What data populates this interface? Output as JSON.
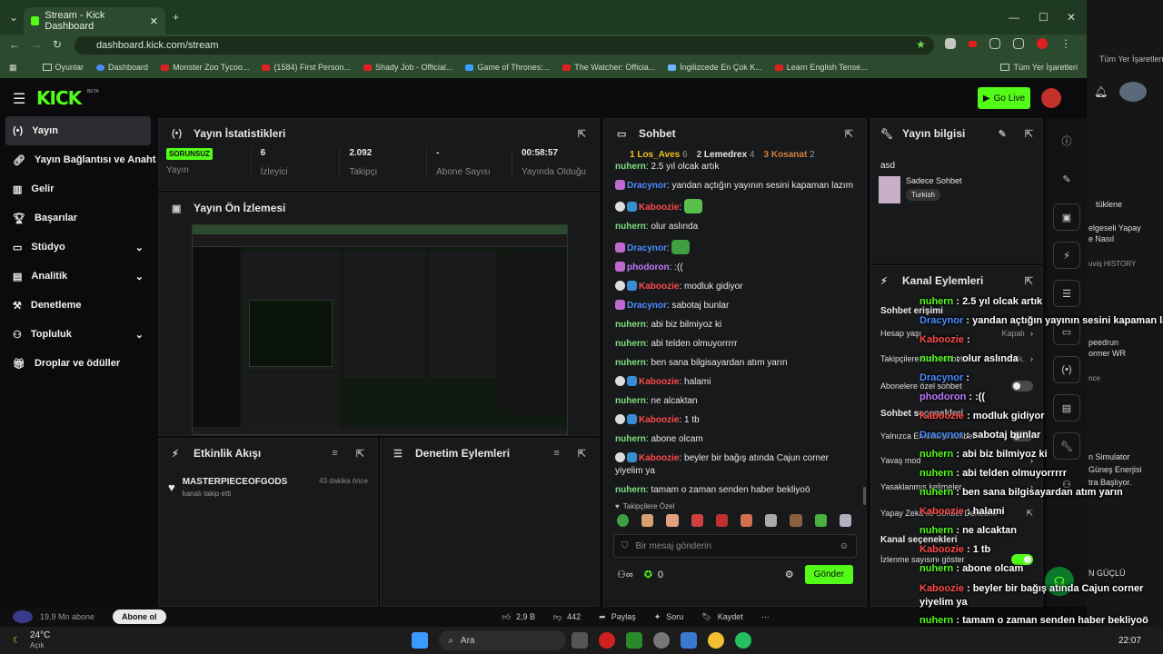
{
  "browser": {
    "tab_title": "Stream - Kick Dashboard",
    "url": "dashboard.kick.com/stream",
    "bookmarks": [
      "Oyunlar",
      "Dashboard",
      "Monster Zoo Tycoo...",
      "(1584) First Person...",
      "Shady Job - Official...",
      "Game of Thrones:...",
      "The Watcher: Officia...",
      "İngilizcede En Çok K...",
      "Learn English Tense...",
      "Tüm Yer İşaretleri"
    ]
  },
  "header": {
    "logo": "KICK",
    "beta": "BETA",
    "go_live": "Go Live"
  },
  "sidebar": {
    "items": [
      {
        "label": "Yayın"
      },
      {
        "label": "Yayın Bağlantısı ve Anahtarı"
      },
      {
        "label": "Gelir"
      },
      {
        "label": "Başarılar"
      },
      {
        "label": "Stüdyo"
      },
      {
        "label": "Analitik"
      },
      {
        "label": "Denetleme"
      },
      {
        "label": "Topluluk"
      },
      {
        "label": "Droplar ve ödüller"
      }
    ]
  },
  "stats": {
    "title": "Yayın İstatistikleri",
    "status": "SORUNSUZ",
    "status_label": "Yayın",
    "viewers": "6",
    "viewers_label": "İzleyici",
    "followers": "2.092",
    "followers_label": "Takipçi",
    "subs": "-",
    "subs_label": "Abone Sayısı",
    "uptime": "00:58:57",
    "uptime_label": "Yayında Olduğu"
  },
  "preview": {
    "title": "Yayın Ön İzlemesi"
  },
  "activity": {
    "title": "Etkinlik Akışı",
    "items": [
      {
        "user": "MASTERPIECEOFGODS",
        "action": "kanalı takip etti",
        "time": "43 dakika önce"
      }
    ]
  },
  "moderation": {
    "title": "Denetim Eylemleri"
  },
  "chat": {
    "title": "Sohbet",
    "leaderboard": [
      {
        "rank": "1",
        "name": "Los_Aves",
        "count": "6"
      },
      {
        "rank": "2",
        "name": "Lemedrex",
        "count": "4"
      },
      {
        "rank": "3",
        "name": "Kosanat",
        "count": "2"
      }
    ],
    "messages": [
      {
        "user": "nuhern",
        "text": "2.5 yıl olcak artık"
      },
      {
        "user": "Dracynor",
        "text": "yandan açtığın yayının sesini kapaman lazım"
      },
      {
        "user": "Kaboozie",
        "text": ""
      },
      {
        "user": "nuhern",
        "text": "olur aslında"
      },
      {
        "user": "Dracynor",
        "text": ""
      },
      {
        "user": "phodoron",
        "text": ":(("
      },
      {
        "user": "Kaboozie",
        "text": "modluk gidiyor"
      },
      {
        "user": "Dracynor",
        "text": "sabotaj bunlar"
      },
      {
        "user": "nuhern",
        "text": "abi biz bilmiyoz ki"
      },
      {
        "user": "nuhern",
        "text": "abi telden olmuyorrrrr"
      },
      {
        "user": "nuhern",
        "text": "ben sana bilgisayardan atım yarın"
      },
      {
        "user": "Kaboozie",
        "text": "halami"
      },
      {
        "user": "nuhern",
        "text": "ne alcaktan"
      },
      {
        "user": "Kaboozie",
        "text": "1 tb"
      },
      {
        "user": "nuhern",
        "text": "abone olcam"
      },
      {
        "user": "Kaboozie",
        "text": "beyler bir bağış atında Cajun corner yiyelim ya"
      },
      {
        "user": "nuhern",
        "text": "tamam o zaman senden haber bekliyoö"
      }
    ],
    "followers_only": "Takipçilere Özel",
    "placeholder": "Bir mesaj gönderin",
    "points": "0",
    "send": "Gönder"
  },
  "info": {
    "title": "Yayın bilgisi",
    "stream_title": "asd",
    "category": "Sadece Sohbet",
    "tag": "Turkish"
  },
  "channel_actions": {
    "title": "Kanal Eylemleri",
    "chat_access": "Sohbet erişimi",
    "rows": [
      {
        "label": "Hesap yaşı",
        "value": "Kapalı"
      },
      {
        "label": "Takipçilere özel sohbet",
        "value": "1 dk."
      },
      {
        "label": "Abonelere özel sohbet",
        "value": ""
      }
    ],
    "chat_options": "Sohbet seçenekleri",
    "options": [
      "Yalnızca Emotlarla sohbet",
      "Yavaş mod",
      "Yasaklanmış kelimeler",
      "Yapay Zeka ile Sohbet Denetimi"
    ],
    "channel_options": "Kanal seçenekleri",
    "channel_rows": [
      "İzlenme sayısını göster"
    ]
  },
  "overlay": [
    {
      "user": "nuhern",
      "text": "2.5 yıl olcak artık"
    },
    {
      "user": "Dracynor",
      "text": "yandan açtığın yayının sesini kapaman lazım"
    },
    {
      "user": "Kaboozie",
      "text": ""
    },
    {
      "user": "nuhern",
      "text": "olur aslında"
    },
    {
      "user": "Dracynor",
      "text": ""
    },
    {
      "user": "phodoron",
      "text": ":(("
    },
    {
      "user": "Kaboozie",
      "text": "modluk gidiyor"
    },
    {
      "user": "Dracynor",
      "text": "sabotaj bunlar"
    },
    {
      "user": "nuhern",
      "text": "abi biz bilmiyoz ki"
    },
    {
      "user": "nuhern",
      "text": "abi telden olmuyorrrrr"
    },
    {
      "user": "nuhern",
      "text": "ben sana bilgisayardan atım yarın"
    },
    {
      "user": "Kaboozie",
      "text": "halami"
    },
    {
      "user": "nuhern",
      "text": "ne alcaktan"
    },
    {
      "user": "Kaboozie",
      "text": "1 tb"
    },
    {
      "user": "nuhern",
      "text": "abone olcam"
    },
    {
      "user": "Kaboozie",
      "text": "beyler bir bağış atında Cajun corner yiyelim ya"
    },
    {
      "user": "nuhern",
      "text": "tamam o zaman senden haber bekliyoö"
    }
  ],
  "background": {
    "views": "19,9 Mn abone",
    "subscribe": "Abone ol",
    "likes": "2,9 B",
    "dislikes": "442",
    "share": "Paylaş",
    "ask": "Soru",
    "save": "Kaydet",
    "right_texts": [
      "Tüm Yer İşaretleri",
      "tüklene",
      "elgeseli Yapay",
      "e Nasıl",
      "uviq HISTORY",
      "peedrun",
      "ormer WR",
      "nce",
      "n Simulator",
      "Güneş Enerjisi",
      "tra Başlıyor.",
      "N GÜÇLÜ"
    ]
  },
  "taskbar": {
    "weather": "24°C",
    "weather_desc": "Açık",
    "search": "Ara",
    "time": "22:07"
  }
}
